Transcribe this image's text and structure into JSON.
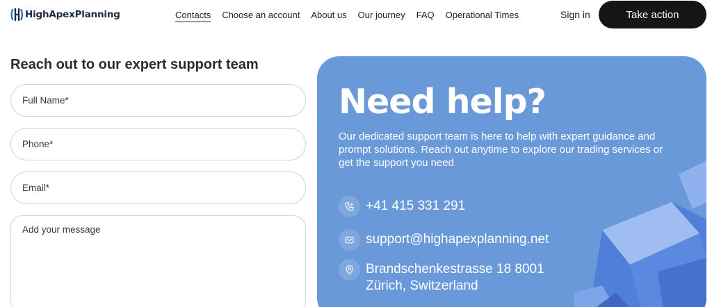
{
  "brand": {
    "name": "HighApexPlanning"
  },
  "nav": {
    "items": [
      "Contacts",
      "Choose an account",
      "About us",
      "Our journey",
      "FAQ",
      "Operational Times"
    ]
  },
  "header": {
    "signin": "Sign in",
    "cta": "Take action"
  },
  "form": {
    "title": "Reach out to our expert support team",
    "full_name_placeholder": "Full Name*",
    "phone_placeholder": "Phone*",
    "email_placeholder": "Email*",
    "message_placeholder": "Add your message"
  },
  "help": {
    "title": "Need help?",
    "description": "Our dedicated support team is here to help with expert guidance and prompt solutions. Reach out anytime to explore our trading services or get the support you need",
    "phone": "+41 415 331 291",
    "email": "support@highapexplanning.net",
    "address_line1": "Brandschenkestrasse 18 8001",
    "address_line2": "Zürich, Switzerland"
  },
  "colors": {
    "card": "#6a99da",
    "cta": "#151515",
    "field_border": "#cfd3db"
  },
  "icons": {
    "logo": "logo-mark-icon",
    "phone": "phone-icon",
    "email": "mail-icon",
    "address": "location-pin-icon"
  }
}
